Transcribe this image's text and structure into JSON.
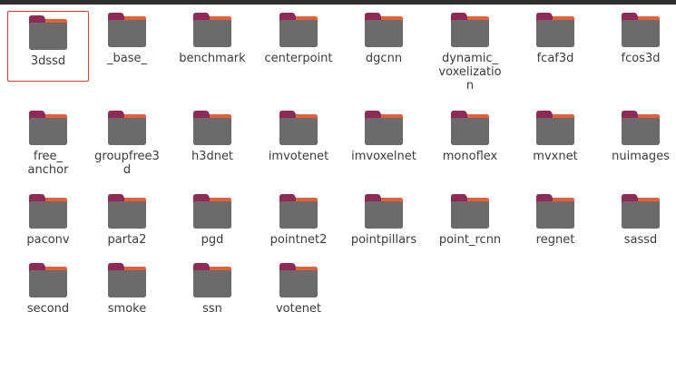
{
  "folders": [
    {
      "name": "3dssd",
      "selected": true
    },
    {
      "name": "_base_"
    },
    {
      "name": "benchmark"
    },
    {
      "name": "centerpoint"
    },
    {
      "name": "dgcnn"
    },
    {
      "name": "dynamic_\nvoxelizatio\nn"
    },
    {
      "name": "fcaf3d"
    },
    {
      "name": "fcos3d"
    },
    {
      "name": "free_\nanchor"
    },
    {
      "name": "groupfree3\nd"
    },
    {
      "name": "h3dnet"
    },
    {
      "name": "imvotenet"
    },
    {
      "name": "imvoxelnet"
    },
    {
      "name": "monoflex"
    },
    {
      "name": "mvxnet"
    },
    {
      "name": "nuimages"
    },
    {
      "name": "paconv"
    },
    {
      "name": "parta2"
    },
    {
      "name": "pgd"
    },
    {
      "name": "pointnet2"
    },
    {
      "name": "pointpillars"
    },
    {
      "name": "point_rcnn"
    },
    {
      "name": "regnet"
    },
    {
      "name": "sassd"
    },
    {
      "name": "second"
    },
    {
      "name": "smoke"
    },
    {
      "name": "ssn"
    },
    {
      "name": "votenet"
    }
  ],
  "colors": {
    "folder_tab": "#8f2a54",
    "folder_tab_edge": "#e2613a",
    "folder_body": "#6b6b6b",
    "selection_border": "#d93a35"
  }
}
